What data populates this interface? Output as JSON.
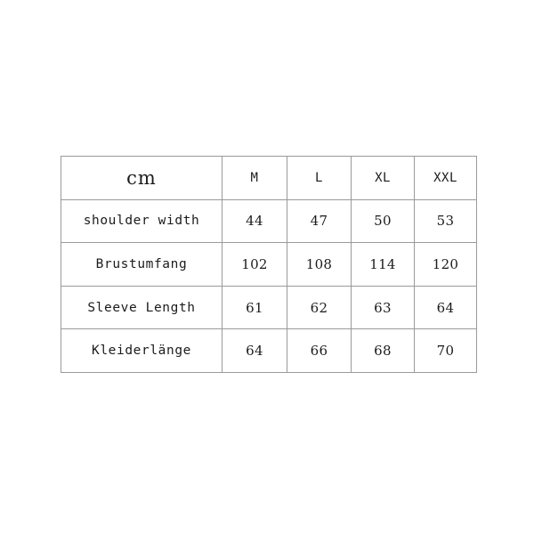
{
  "page": {
    "background_color": "#ffffff",
    "border_color": "#9a9a9a",
    "text_color": "#1b1b1b"
  },
  "size_chart": {
    "unit_label": "cm",
    "size_columns": [
      "M",
      "L",
      "XL",
      "XXL"
    ],
    "rows": [
      {
        "label": "shoulder width",
        "values": [
          "44",
          "47",
          "50",
          "53"
        ]
      },
      {
        "label": "Brustumfang",
        "values": [
          "102",
          "108",
          "114",
          "120"
        ]
      },
      {
        "label": "Sleeve Length",
        "values": [
          "61",
          "62",
          "63",
          "64"
        ]
      },
      {
        "label": "Kleiderlänge",
        "values": [
          "64",
          "66",
          "68",
          "70"
        ]
      }
    ]
  }
}
